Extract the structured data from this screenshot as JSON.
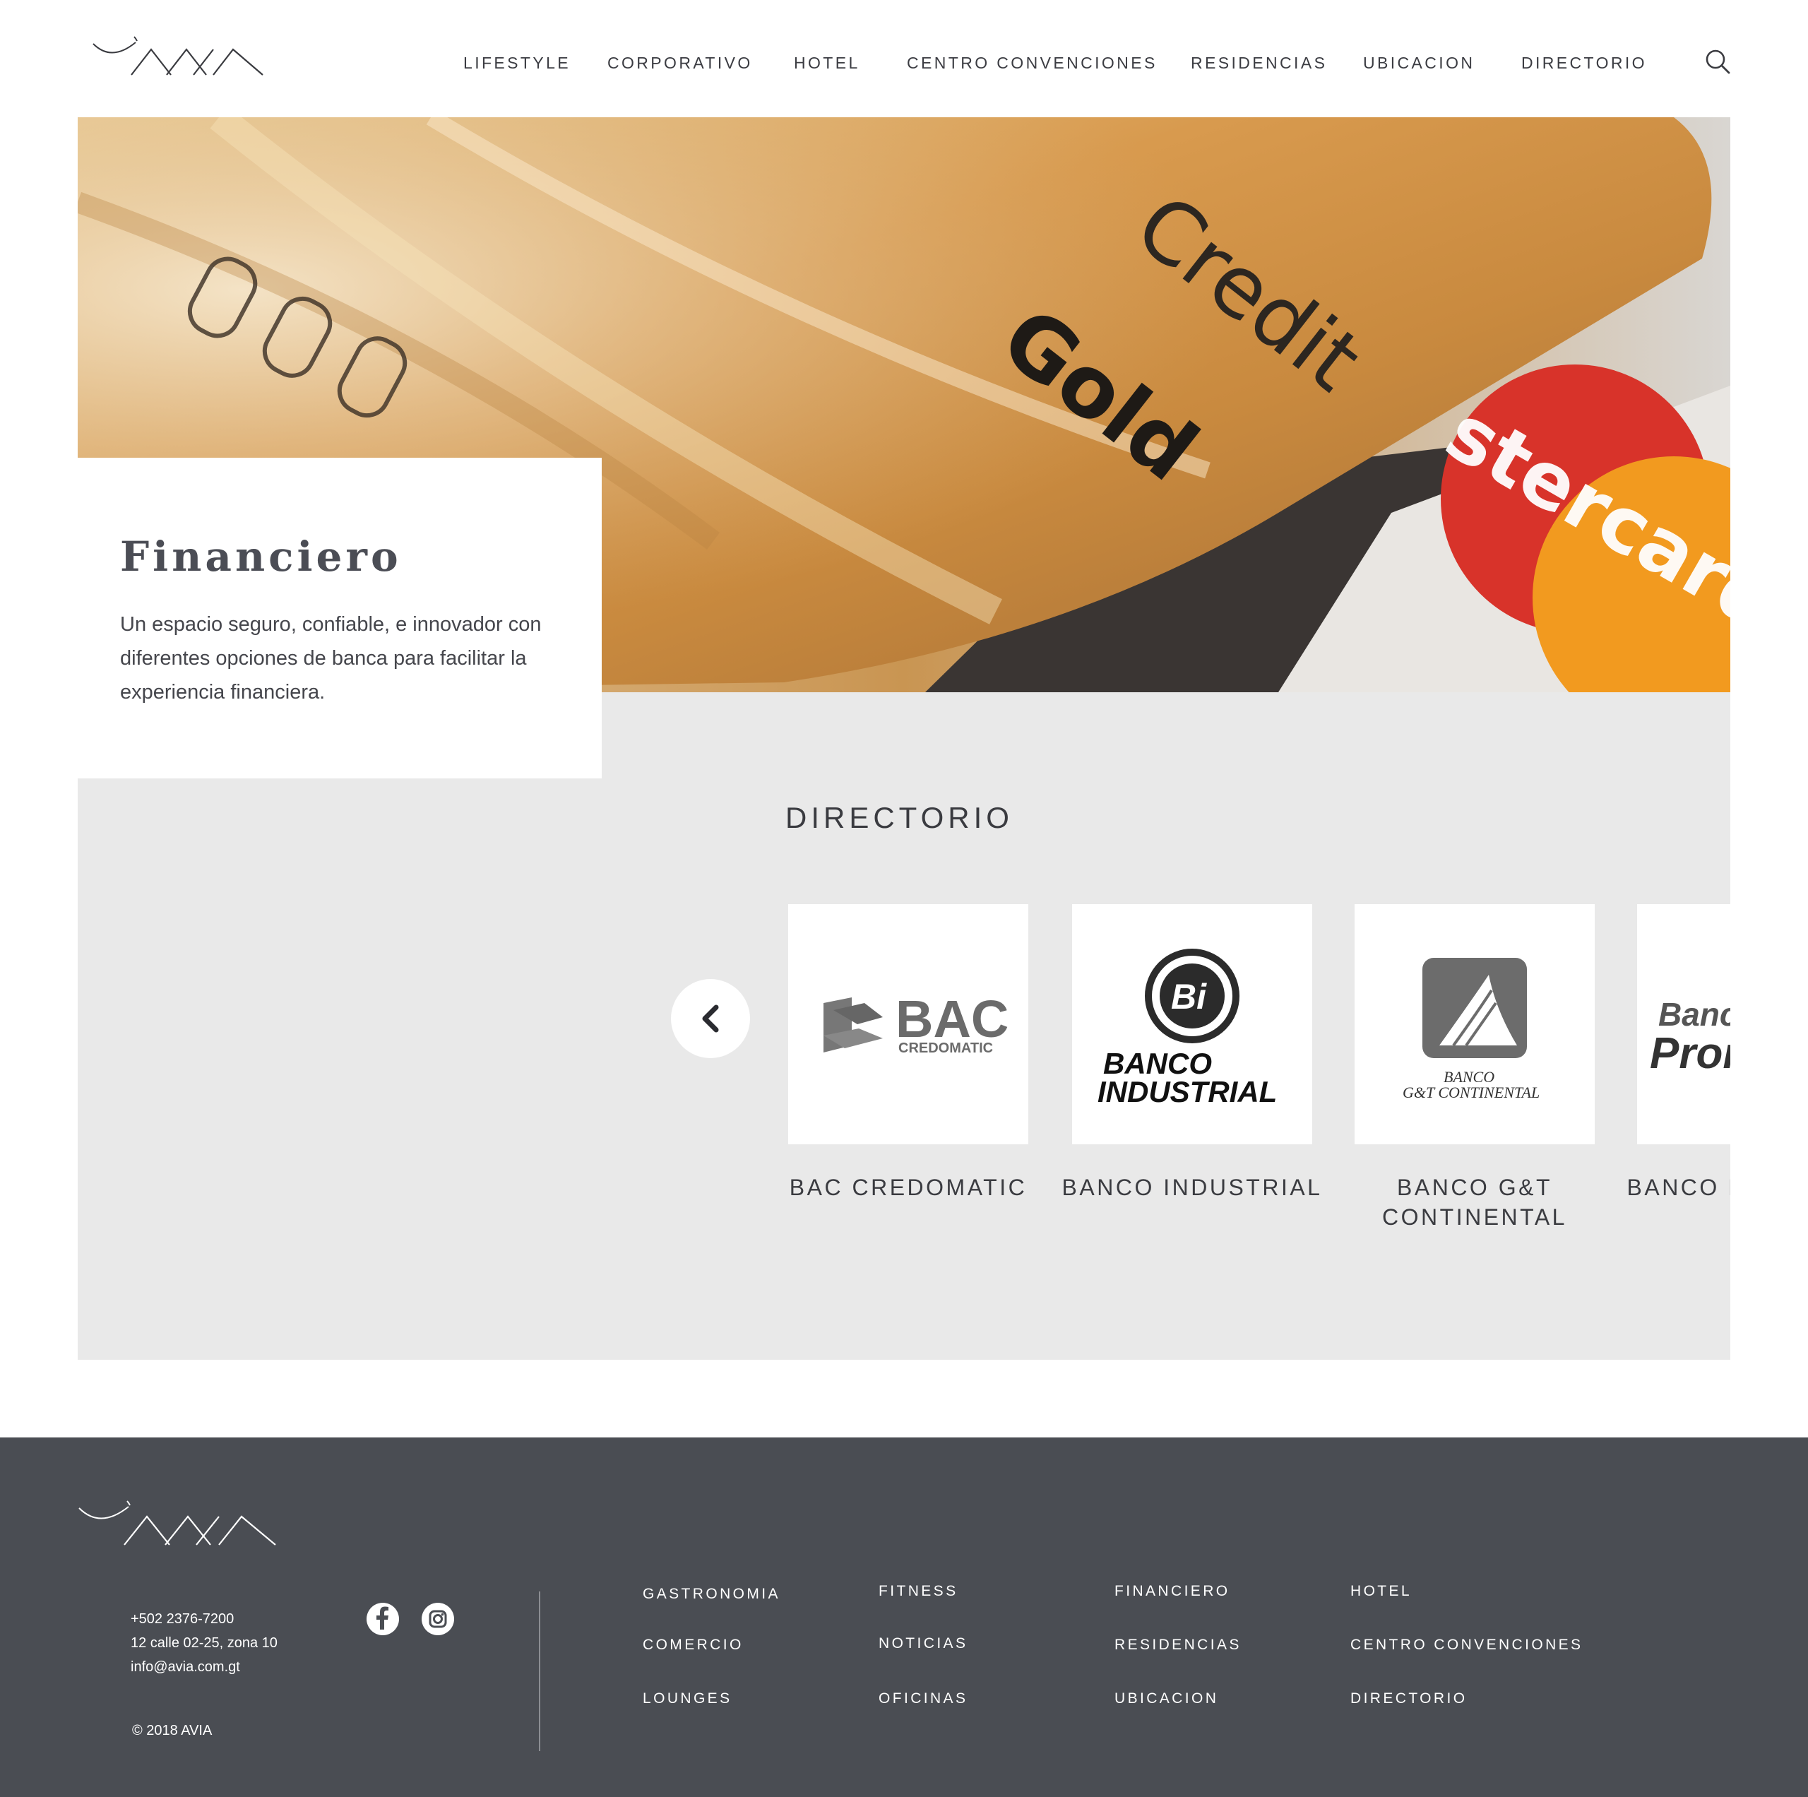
{
  "brand": {
    "name": "AVIA"
  },
  "nav": {
    "items": [
      "LIFESTYLE",
      "CORPORATIVO",
      "HOTEL",
      "CENTRO CONVENCIONES",
      "RESIDENCIAS",
      "UBICACION",
      "DIRECTORIO"
    ]
  },
  "hero": {
    "image_text_1": "Credit",
    "image_text_2": "Gold",
    "image_text_3": "stercard"
  },
  "category": {
    "title": "Financiero",
    "description": "Un espacio seguro, confiable, e innovador con diferentes opciones de banca para facilitar la experiencia financiera."
  },
  "directory": {
    "title": "DIRECTORIO",
    "cards": [
      {
        "name": "BAC CREDOMATIC"
      },
      {
        "name": "BANCO INDUSTRIAL"
      },
      {
        "name": "BANCO G&T CONTINENTAL"
      },
      {
        "name": "BANCO PROMERICA"
      }
    ]
  },
  "footer": {
    "phone": "+502 2376-7200",
    "address": "12 calle 02-25, zona 10",
    "email": "info@avia.com.gt",
    "copyright": "© 2018 AVIA",
    "links": [
      "GASTRONOMIA",
      "FITNESS",
      "FINANCIERO",
      "HOTEL",
      "COMERCIO",
      "NOTICIAS",
      "RESIDENCIAS",
      "CENTRO CONVENCIONES",
      "LOUNGES",
      "OFICINAS",
      "UBICACION",
      "DIRECTORIO"
    ]
  },
  "colors": {
    "footer_bg": "#4a4d53",
    "panel_bg": "#e9e9e9",
    "text_dark": "#3a3b40",
    "gold": "#d8a55a"
  },
  "icons": [
    "search-icon",
    "chevron-left-icon",
    "facebook-icon",
    "instagram-icon"
  ]
}
